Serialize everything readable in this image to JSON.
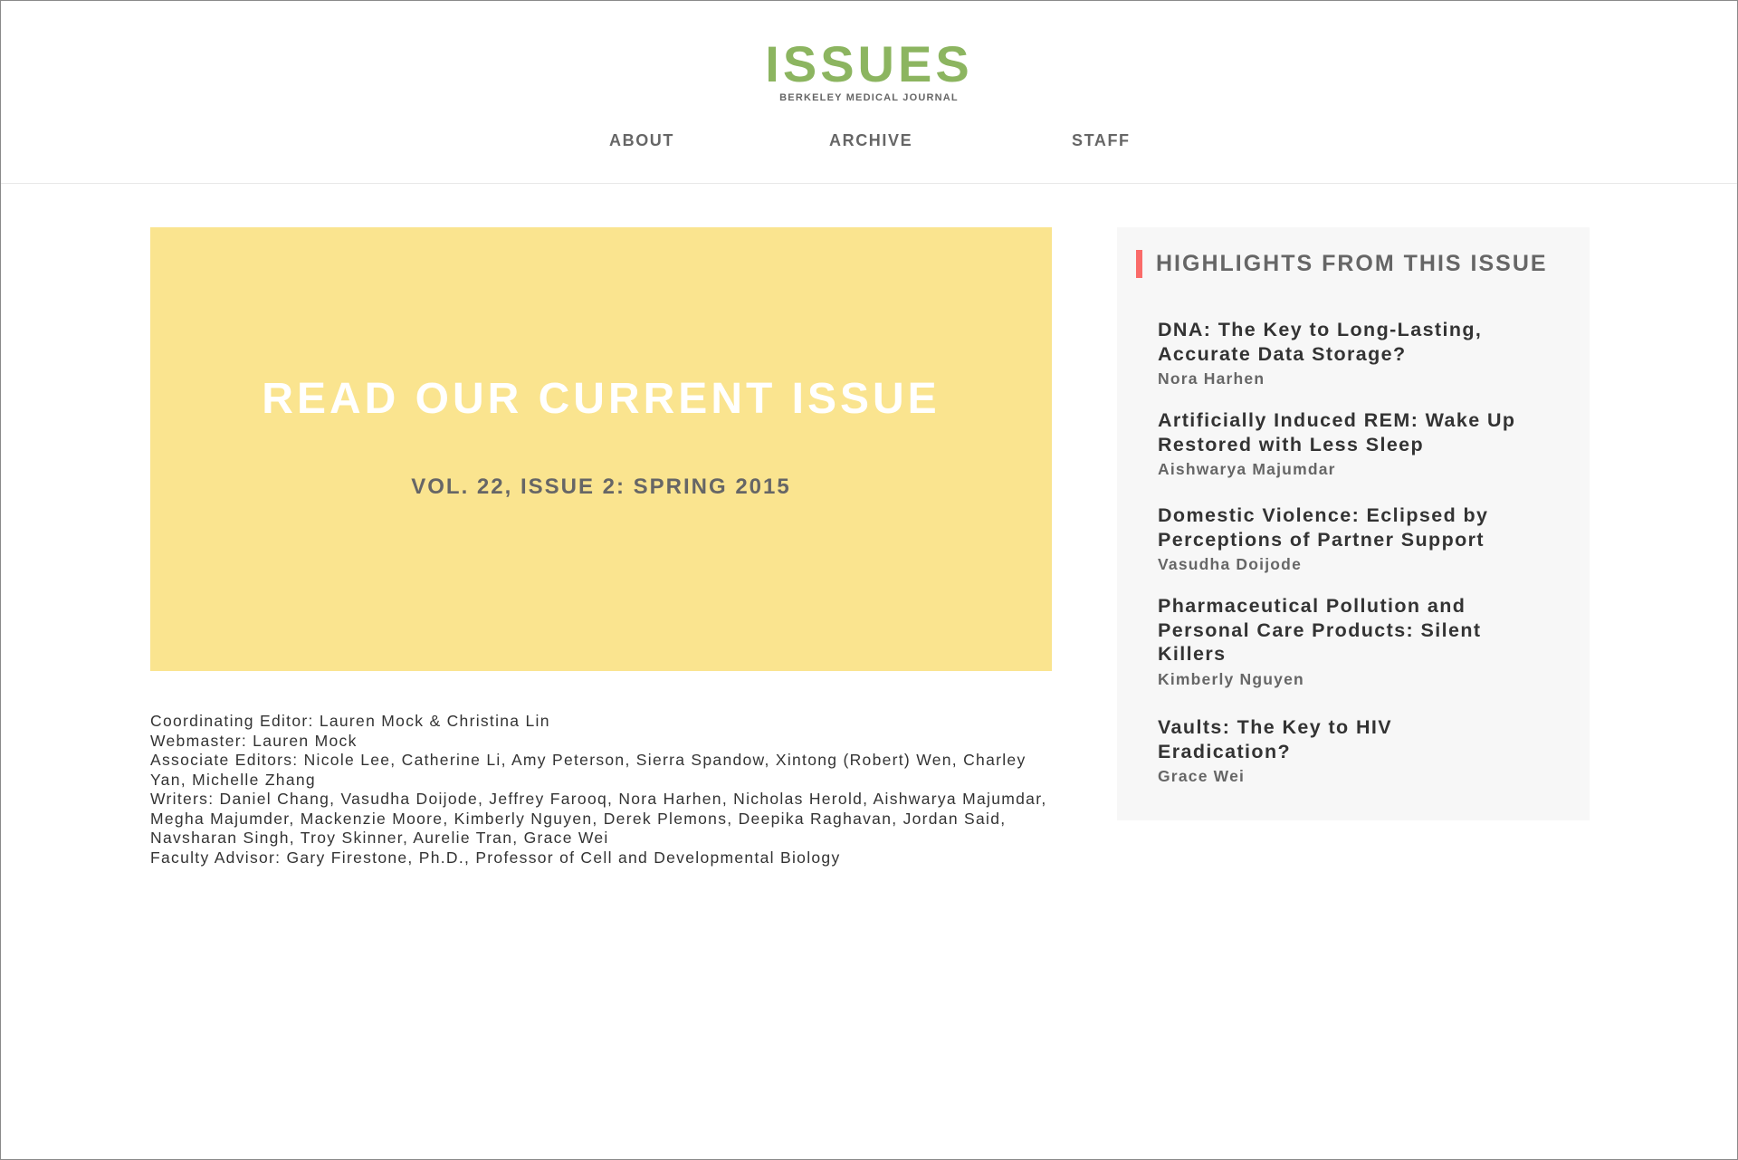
{
  "header": {
    "logo_title": "ISSUES",
    "logo_subtitle": "BERKELEY MEDICAL JOURNAL",
    "nav": {
      "about": "ABOUT",
      "archive": "ARCHIVE",
      "staff": "STAFF"
    }
  },
  "hero": {
    "title": "READ OUR CURRENT ISSUE",
    "subtitle": "VOL. 22, ISSUE 2: SPRING 2015",
    "background_color": "#fae48f"
  },
  "credits": [
    "Coordinating Editor: Lauren Mock & Christina Lin",
    "Webmaster: Lauren Mock",
    "Associate Editors: Nicole Lee, Catherine Li, Amy Peterson, Sierra Spandow, Xintong (Robert) Wen, Charley Yan, Michelle Zhang",
    "Writers: Daniel Chang, Vasudha Doijode, Jeffrey Farooq, Nora Harhen, Nicholas Herold, Aishwarya Majumdar, Megha Majumder, Mackenzie Moore, Kimberly Nguyen, Derek Plemons, Deepika Raghavan, Jordan Said, Navsharan Singh, Troy Skinner, Aurelie Tran, Grace Wei",
    "Faculty Advisor: Gary Firestone, Ph.D., Professor of Cell and Developmental Biology"
  ],
  "sidebar": {
    "heading": "HIGHLIGHTS FROM THIS ISSUE",
    "accent_color": "#fa6b69",
    "highlights": [
      {
        "title": "DNA: The Key to Long-Lasting, Accurate Data Storage?",
        "author": "Nora Harhen"
      },
      {
        "title": "Artificially Induced REM: Wake Up Restored with Less Sleep",
        "author": "Aishwarya Majumdar"
      },
      {
        "title": "Domestic Violence: Eclipsed by Perceptions of Partner Support",
        "author": "Vasudha Doijode"
      },
      {
        "title": "Pharmaceutical Pollution and Personal Care Products: Silent Killers",
        "author": "Kimberly Nguyen"
      },
      {
        "title": "Vaults: The Key to HIV Eradication?",
        "author": "Grace Wei"
      }
    ]
  },
  "colors": {
    "logo_green": "#8cb560",
    "text_dark": "#333333",
    "text_gray": "#666666",
    "sidebar_bg": "#f7f7f7"
  }
}
